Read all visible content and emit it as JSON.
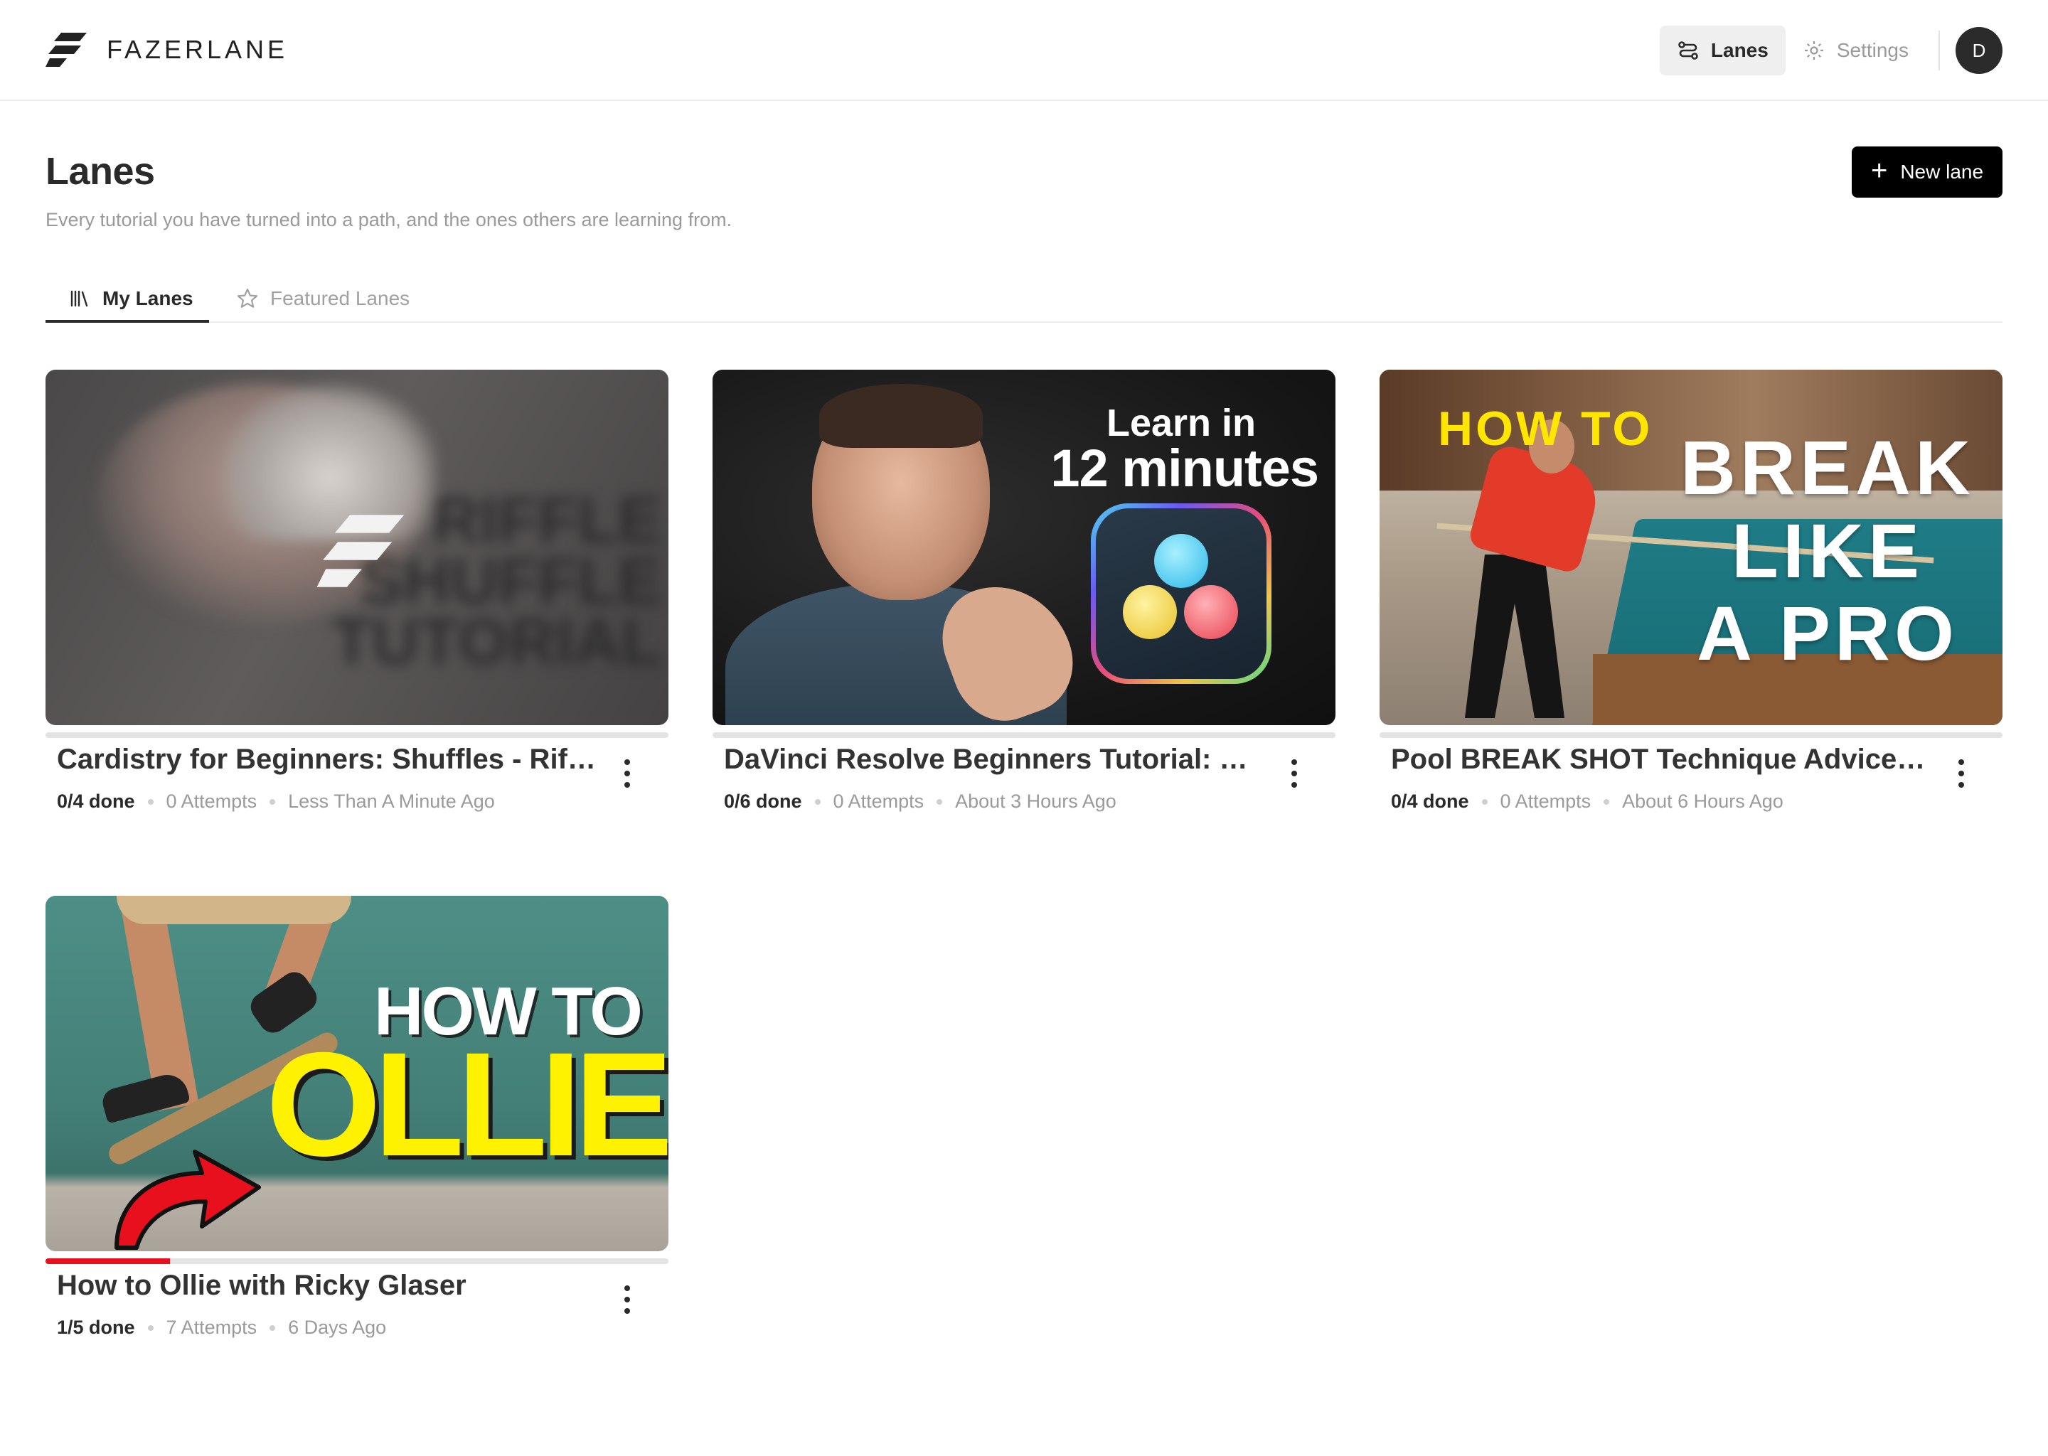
{
  "brand": {
    "name": "FAZERLANE"
  },
  "nav": {
    "lanes_label": "Lanes",
    "settings_label": "Settings",
    "avatar_initial": "D"
  },
  "header": {
    "title": "Lanes",
    "subtitle": "Every tutorial you have turned into a path, and the ones others are learning from.",
    "new_lane_label": "New lane"
  },
  "tabs": [
    {
      "label": "My Lanes",
      "icon": "library-icon",
      "active": true
    },
    {
      "label": "Featured Lanes",
      "icon": "star-icon",
      "active": false
    }
  ],
  "lanes": [
    {
      "title": "Cardistry for Beginners: Shuffles - Riffl...",
      "done": "0/4 done",
      "attempts": "0 Attempts",
      "updated": "Less Than A Minute Ago",
      "progress": 0,
      "thumbnail_text": [
        "RIFFLE",
        "SHUFFLE",
        "TUTORIAL"
      ]
    },
    {
      "title": "DaVinci Resolve Beginners Tutorial: Ed...",
      "done": "0/6 done",
      "attempts": "0 Attempts",
      "updated": "About 3 Hours Ago",
      "progress": 0,
      "thumbnail_text": [
        "Learn in",
        "12 minutes"
      ]
    },
    {
      "title": "Pool BREAK SHOT Technique Advice -...",
      "done": "0/4 done",
      "attempts": "0 Attempts",
      "updated": "About 6 Hours Ago",
      "progress": 0,
      "thumbnail_text": [
        "HOW TO",
        "BREAK",
        "LIKE",
        "A PRO"
      ]
    },
    {
      "title": "How to Ollie with Ricky Glaser",
      "done": "1/5 done",
      "attempts": "7 Attempts",
      "updated": "6 Days Ago",
      "progress": 0.2,
      "thumbnail_text": [
        "HOW TO",
        "OLLIE"
      ]
    }
  ],
  "colors": {
    "accent": "#000000",
    "progress": "#e8101d",
    "muted_text": "#9a9a9a"
  }
}
